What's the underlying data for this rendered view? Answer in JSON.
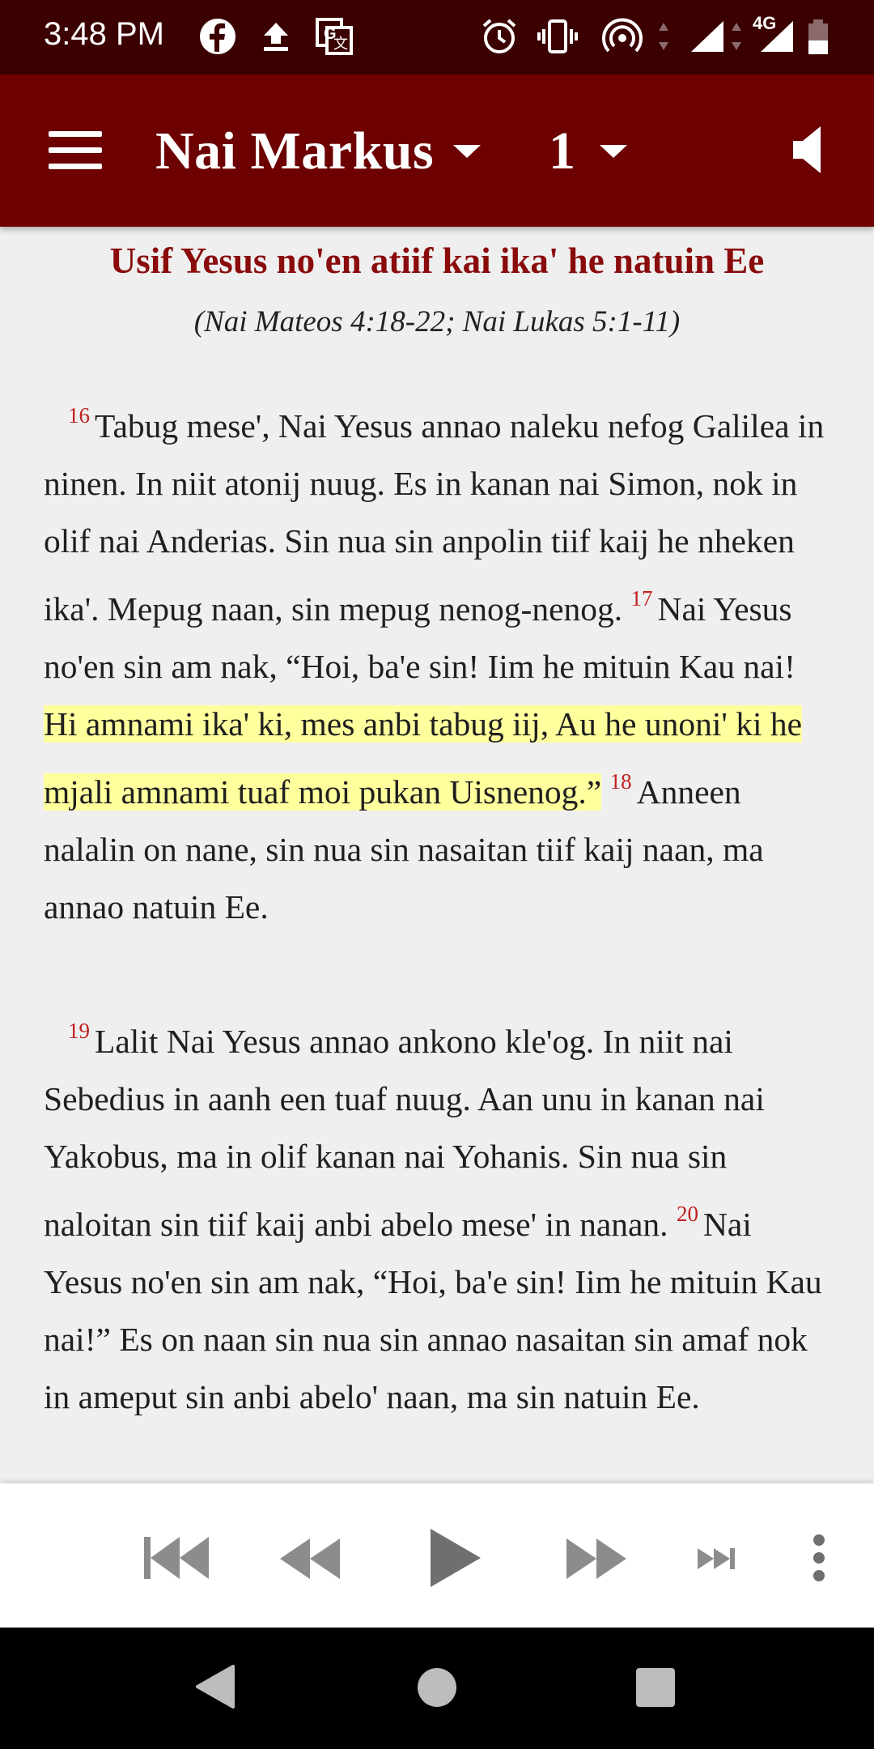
{
  "status_bar": {
    "time": "3:48 PM",
    "icons": [
      "facebook-icon",
      "upload-icon",
      "translate-icon",
      "alarm-icon",
      "vibrate-icon",
      "hotspot-icon",
      "signal-icon",
      "4g-signal-icon",
      "battery-icon"
    ],
    "network_label": "4G"
  },
  "app_bar": {
    "book": "Nai Markus",
    "chapter": "1"
  },
  "section": {
    "heading": "Usif Yesus no'en atiif kai ika' he natuin Ee",
    "reference": "(Nai Mateos 4:18-22; Nai Lukas 5:1-11)"
  },
  "verses": {
    "v16_num": "16",
    "v16_text": "Tabug mese', Nai Yesus annao naleku nefog Galilea in ninen. In niit atonij nuug. Es in kanan nai Simon, nok in olif nai Anderias. Sin nua sin anpolin tiif kaij he nheken ika'. Mepug naan, sin mepug nenog-nenog.",
    "v17_num": "17",
    "v17_text": "Nai Yesus no'en sin am nak, “Hoi, ba'e sin! Iim he mituin Kau nai!",
    "v17_highlight": "Hi amnami ika' ki, mes anbi tabug iij, Au he unoni' ki he mjali amnami tuaf moi pukan Uisnenog.”",
    "v18_num": "18",
    "v18_text": "Anneen nalalin on nane, sin nua sin nasaitan tiif kaij naan, ma annao natuin Ee.",
    "v19_num": "19",
    "v19_text": "Lalit Nai Yesus annao ankono kle'og. In niit nai Sebedius in aanh een tuaf nuug. Aan unu in kanan nai Yakobus, ma in olif kanan nai Yohanis. Sin nua sin naloitan sin tiif kaij anbi abelo mese' in nanan.",
    "v20_num": "20",
    "v20_text": "Nai Yesus no'en sin am nak, “Hoi, ba'e sin! Iim he mituin Kau nai!” Es on naan sin nua sin annao nasaitan sin amaf nok in ameput sin anbi abelo' naan, ma sin natuin Ee."
  },
  "colors": {
    "status_bar": "#3b0000",
    "app_bar": "#6d0000",
    "heading": "#8a0b0b",
    "verse_number": "#c02020",
    "highlight": "#ffff9e",
    "player_icons": "#8c8c8c"
  },
  "player": {
    "icons": [
      "skip-to-start-icon",
      "rewind-icon",
      "play-icon",
      "fast-forward-icon",
      "skip-to-end-icon",
      "more-vert-icon"
    ]
  },
  "nav": {
    "icons": [
      "back-icon",
      "home-icon",
      "recents-icon"
    ]
  }
}
